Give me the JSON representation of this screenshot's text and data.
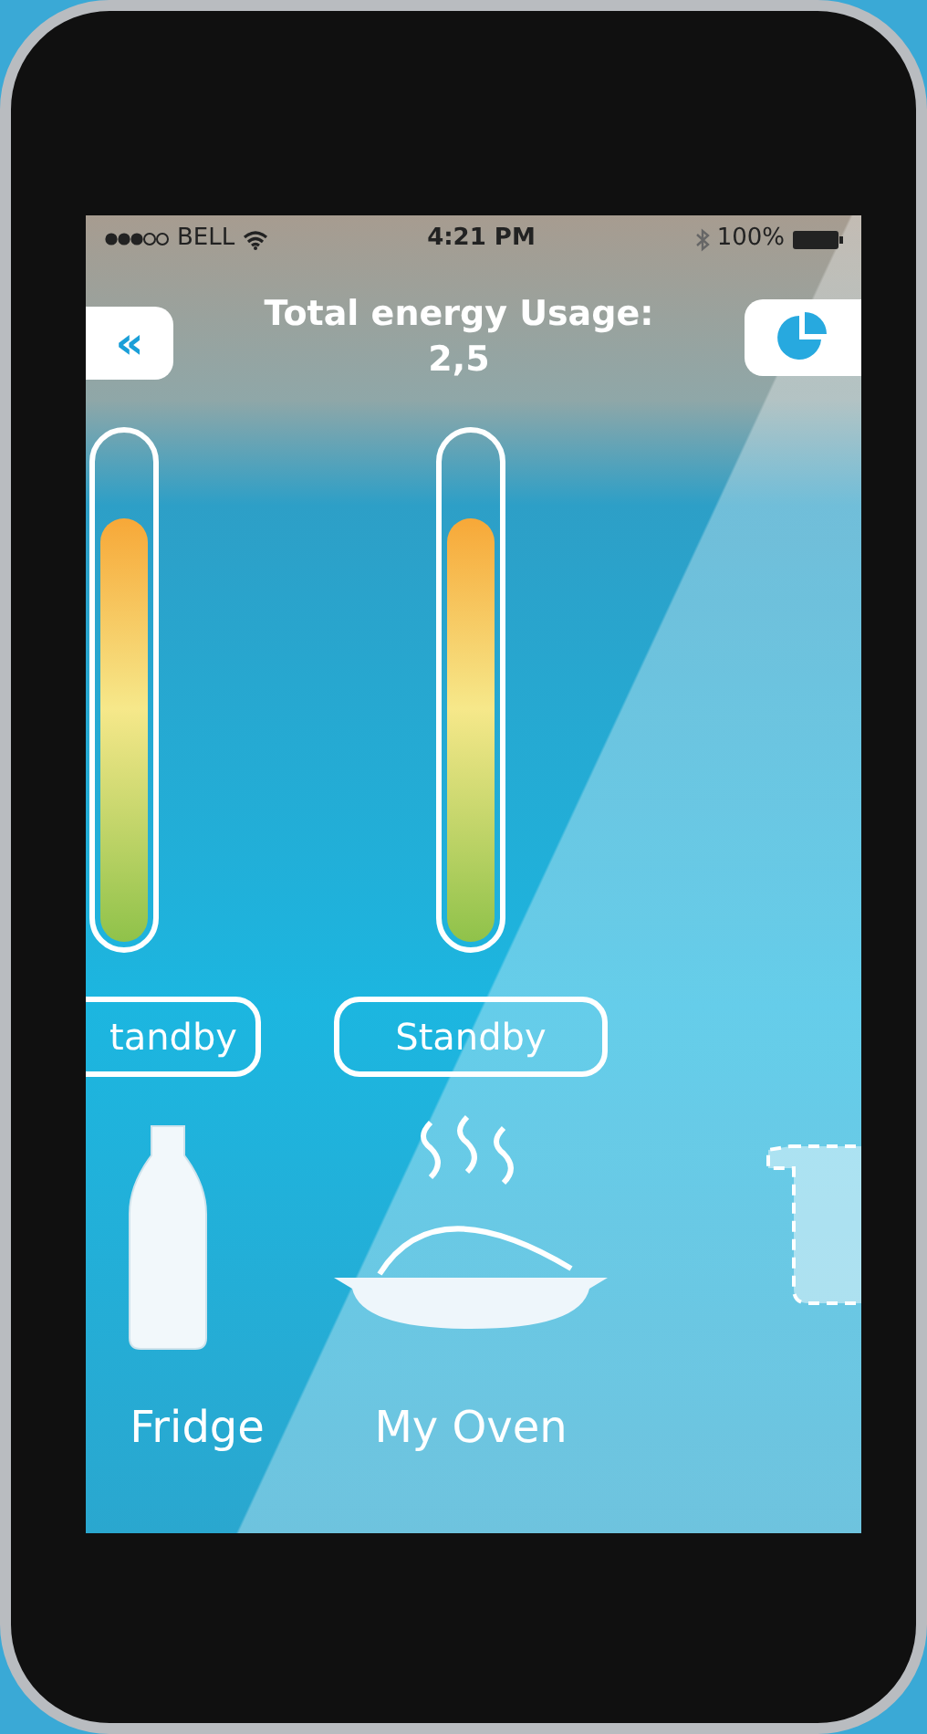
{
  "status_bar": {
    "carrier": "BELL",
    "time": "4:21 PM",
    "battery": "100%"
  },
  "header": {
    "back_label": "«",
    "title": "Total energy Usage:",
    "value": "2,5"
  },
  "appliances": [
    {
      "kind": "bottle",
      "name": "Fridge",
      "status": "tandby",
      "level": 0.84
    },
    {
      "kind": "dish",
      "name": "My Oven",
      "status": "Standby",
      "level": 0.84
    },
    {
      "kind": "pot"
    }
  ]
}
